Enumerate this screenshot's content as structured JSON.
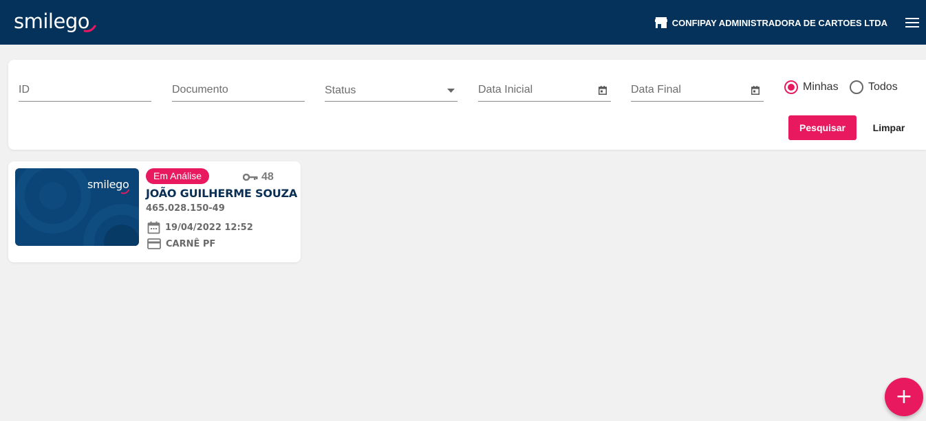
{
  "header": {
    "logo_text": "smilego",
    "company_name": "CONFIPAY ADMINISTRADORA DE CARTOES LTDA",
    "store_icon": "store-icon",
    "menu_icon": "hamburger-menu-icon",
    "background_color": "#04325a"
  },
  "filters": {
    "id_placeholder": "ID",
    "document_placeholder": "Documento",
    "status_label": "Status",
    "start_date_placeholder": "Data Inicial",
    "end_date_placeholder": "Data Final",
    "scope_options": [
      {
        "label": "Minhas",
        "checked": true
      },
      {
        "label": "Todos",
        "checked": false
      }
    ],
    "search_button": "Pesquisar",
    "clear_button": "Limpar"
  },
  "proposals": [
    {
      "thumb_logo": "smilego",
      "status": "Em Análise",
      "id": "48",
      "name": "JOÃO GUILHERME SOUZA",
      "document": "465.028.150-49",
      "date": "19/04/2022 12:52",
      "product": "CARNÊ PF"
    }
  ],
  "fab_label": "+",
  "colors": {
    "accent": "#e8195e",
    "navy": "#04325a",
    "text_dark": "#0a2f55"
  }
}
